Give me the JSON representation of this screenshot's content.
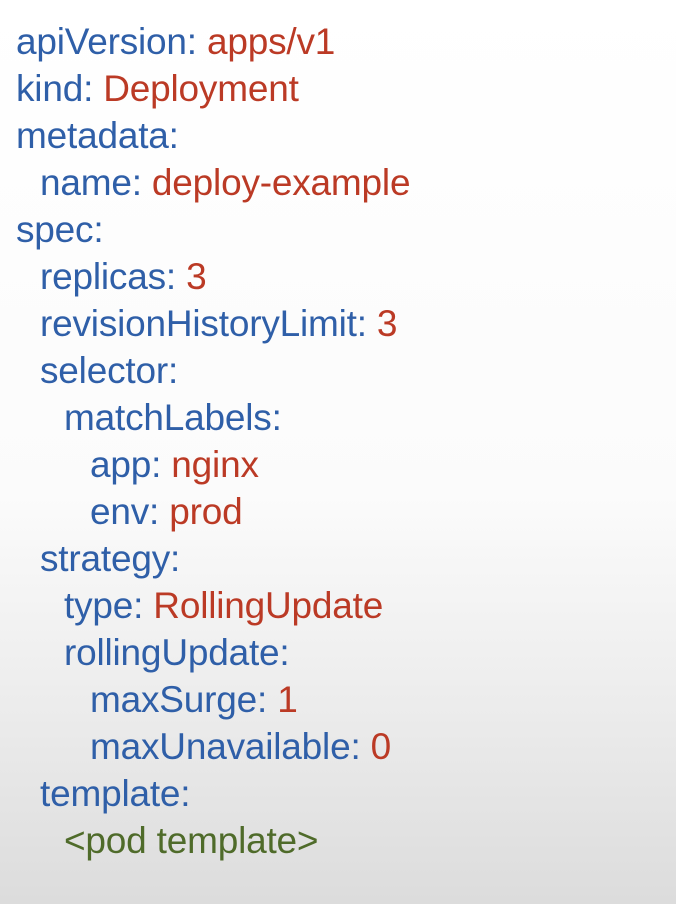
{
  "colors": {
    "key": "#2f5fa8",
    "value": "#bb3a25",
    "placeholder": "#4f6b2a"
  },
  "yaml": {
    "lines": [
      {
        "key": "apiVersion: ",
        "value": "apps/v1"
      },
      {
        "key": "kind: ",
        "value": "Deployment"
      },
      {
        "key": "metadata:",
        "value": ""
      },
      {
        "key": "name: ",
        "value": "deploy-example"
      },
      {
        "key": "spec:",
        "value": ""
      },
      {
        "key": "replicas: ",
        "value": "3"
      },
      {
        "key": "revisionHistoryLimit: ",
        "value": "3"
      },
      {
        "key": "selector:",
        "value": ""
      },
      {
        "key": "matchLabels:",
        "value": ""
      },
      {
        "key": "app: ",
        "value": "nginx"
      },
      {
        "key": "env: ",
        "value": "prod"
      },
      {
        "key": "strategy:",
        "value": ""
      },
      {
        "key": "type: ",
        "value": "RollingUpdate"
      },
      {
        "key": "rollingUpdate:",
        "value": ""
      },
      {
        "key": "maxSurge: ",
        "value": "1"
      },
      {
        "key": "maxUnavailable: ",
        "value": "0"
      },
      {
        "key": "template:",
        "value": ""
      }
    ],
    "placeholder": "<pod template>"
  }
}
